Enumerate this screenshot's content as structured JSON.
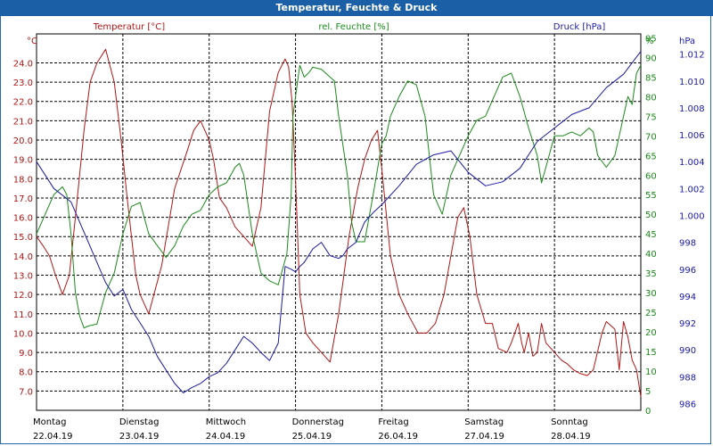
{
  "window": {
    "title": "Temperatur, Feuchte & Druck"
  },
  "colors": {
    "temperature": "#b31515",
    "humidity": "#1a8a1a",
    "pressure": "#1a1aa8",
    "titlebar": "#1b5fa6"
  },
  "chart_data": {
    "type": "line",
    "title": "Temperatur, Feuchte & Druck",
    "grid": true,
    "x": {
      "range_days": [
        0,
        7
      ],
      "days": [
        {
          "name": "Montag",
          "date": "22.04.19"
        },
        {
          "name": "Dienstag",
          "date": "23.04.19"
        },
        {
          "name": "Mittwoch",
          "date": "24.04.19"
        },
        {
          "name": "Donnerstag",
          "date": "25.04.19"
        },
        {
          "name": "Freitag",
          "date": "26.04.19"
        },
        {
          "name": "Samstag",
          "date": "27.04.19"
        },
        {
          "name": "Sonntag",
          "date": "28.04.19"
        }
      ]
    },
    "axes": {
      "temperature": {
        "unit": "°C",
        "label": "Temperatur [°C]",
        "min": 6.0,
        "max": 25.5,
        "ticks": [
          "7.0",
          "8.0",
          "9.0",
          "10.0",
          "11.0",
          "12.0",
          "13.0",
          "14.0",
          "15.0",
          "16.0",
          "17.0",
          "18.0",
          "19.0",
          "20.0",
          "21.0",
          "22.0",
          "23.0",
          "24.0"
        ]
      },
      "humidity": {
        "unit": "%",
        "label": "rel. Feuchte [%]",
        "min": 0,
        "max": 96,
        "ticks": [
          "0",
          "5",
          "10",
          "15",
          "20",
          "25",
          "30",
          "35",
          "40",
          "45",
          "50",
          "55",
          "60",
          "65",
          "70",
          "75",
          "80",
          "85",
          "90",
          "95"
        ]
      },
      "pressure": {
        "unit": "hPa",
        "label": "Druck [hPa]",
        "min": 985.5,
        "max": 1013.5,
        "ticks": [
          "986",
          "988",
          "990",
          "992",
          "994",
          "996",
          "998",
          "1.000",
          "1.002",
          "1.004",
          "1.006",
          "1.008",
          "1.010",
          "1.012"
        ]
      }
    },
    "series": [
      {
        "name": "Temperatur [°C]",
        "axis": "temperature",
        "color": "#b31515",
        "x": [
          0,
          0.08,
          0.15,
          0.22,
          0.3,
          0.38,
          0.45,
          0.55,
          0.62,
          0.7,
          0.8,
          0.9,
          0.98,
          1.05,
          1.1,
          1.15,
          1.2,
          1.3,
          1.45,
          1.6,
          1.75,
          1.82,
          1.9,
          2.0,
          2.05,
          2.12,
          2.2,
          2.3,
          2.4,
          2.5,
          2.6,
          2.7,
          2.8,
          2.88,
          2.92,
          2.96,
          3.0,
          3.05,
          3.12,
          3.2,
          3.3,
          3.4,
          3.5,
          3.62,
          3.72,
          3.8,
          3.88,
          3.95,
          4.0,
          4.1,
          4.2,
          4.3,
          4.42,
          4.52,
          4.62,
          4.72,
          4.8,
          4.88,
          4.95,
          5.02,
          5.1,
          5.2,
          5.28,
          5.35,
          5.45,
          5.5,
          5.58,
          5.62,
          5.65,
          5.7,
          5.75,
          5.8,
          5.85,
          5.9,
          6.0,
          6.08,
          6.15,
          6.22,
          6.3,
          6.38,
          6.45,
          6.55,
          6.6,
          6.65,
          6.7,
          6.75,
          6.8,
          6.85,
          6.9,
          6.95,
          7.0
        ],
        "y": [
          15.0,
          14.5,
          14.0,
          13.0,
          12.0,
          13.0,
          16.0,
          20.5,
          23.0,
          24.0,
          24.7,
          23.0,
          20.0,
          17.0,
          15.0,
          13.0,
          12.0,
          11.0,
          13.5,
          17.5,
          19.5,
          20.5,
          21.0,
          20.0,
          19.0,
          17.0,
          16.5,
          15.5,
          15.0,
          14.5,
          16.5,
          21.5,
          23.5,
          24.2,
          23.8,
          22.0,
          18.0,
          12.0,
          10.0,
          9.5,
          9.0,
          8.5,
          11.0,
          15.0,
          17.5,
          19.0,
          20.0,
          20.5,
          18.5,
          14.0,
          12.0,
          11.0,
          10.0,
          10.0,
          10.5,
          12.0,
          14.0,
          16.0,
          16.5,
          15.0,
          12.0,
          10.5,
          10.5,
          9.2,
          9.0,
          9.5,
          10.5,
          9.5,
          9.0,
          10.0,
          8.8,
          9.0,
          10.5,
          9.5,
          9.0,
          8.6,
          8.4,
          8.1,
          7.9,
          7.8,
          8.1,
          10.0,
          10.6,
          10.4,
          10.2,
          8.1,
          10.6,
          9.8,
          8.6,
          8.1,
          6.7
        ]
      },
      {
        "name": "rel. Feuchte [%]",
        "axis": "humidity",
        "color": "#1a8a1a",
        "x": [
          0,
          0.1,
          0.2,
          0.3,
          0.35,
          0.4,
          0.45,
          0.5,
          0.55,
          0.6,
          0.7,
          0.8,
          0.9,
          1.0,
          1.1,
          1.2,
          1.3,
          1.4,
          1.5,
          1.6,
          1.7,
          1.8,
          1.9,
          2.0,
          2.1,
          2.2,
          2.3,
          2.35,
          2.4,
          2.5,
          2.6,
          2.7,
          2.8,
          2.9,
          2.95,
          2.97,
          3.0,
          3.05,
          3.1,
          3.15,
          3.2,
          3.3,
          3.4,
          3.45,
          3.5,
          3.6,
          3.65,
          3.7,
          3.8,
          3.9,
          4.0,
          4.05,
          4.1,
          4.2,
          4.3,
          4.4,
          4.5,
          4.6,
          4.7,
          4.8,
          4.9,
          5.0,
          5.1,
          5.2,
          5.3,
          5.4,
          5.5,
          5.6,
          5.7,
          5.8,
          5.85,
          5.9,
          6.0,
          6.1,
          6.2,
          6.3,
          6.4,
          6.45,
          6.5,
          6.6,
          6.7,
          6.75,
          6.8,
          6.85,
          6.9,
          6.95,
          7.0
        ],
        "y": [
          45.0,
          50.0,
          55.0,
          57.0,
          55.0,
          45.0,
          30.0,
          24.0,
          21.0,
          21.5,
          22.0,
          30.0,
          35.0,
          45.0,
          52.0,
          53.0,
          45.0,
          42.0,
          39.0,
          42.0,
          47.0,
          50.0,
          51.0,
          55.0,
          57.0,
          58.0,
          62.0,
          63.0,
          60.0,
          45.0,
          35.0,
          33.0,
          32.0,
          40.0,
          55.0,
          75.0,
          80.0,
          88.0,
          85.0,
          86.0,
          87.5,
          87.0,
          85.0,
          84.0,
          75.0,
          60.0,
          48.0,
          43.0,
          43.0,
          55.0,
          68.0,
          70.0,
          75.0,
          80.0,
          84.0,
          83.0,
          75.0,
          55.0,
          50.0,
          60.0,
          65.0,
          70.0,
          74.0,
          75.0,
          80.0,
          85.0,
          86.0,
          80.0,
          72.0,
          65.0,
          58.0,
          62.0,
          70.0,
          70.0,
          71.0,
          70.0,
          72.0,
          71.0,
          65.0,
          62.0,
          65.0,
          70.0,
          75.0,
          80.0,
          78.0,
          86.0,
          88.0
        ]
      },
      {
        "name": "Druck [hPa]",
        "axis": "pressure",
        "color": "#1a1aa8",
        "x": [
          0,
          0.2,
          0.4,
          0.6,
          0.8,
          0.9,
          1.0,
          1.1,
          1.2,
          1.3,
          1.4,
          1.5,
          1.6,
          1.7,
          1.8,
          1.9,
          2.0,
          2.1,
          2.2,
          2.3,
          2.4,
          2.5,
          2.6,
          2.7,
          2.8,
          2.88,
          2.95,
          3.0,
          3.05,
          3.1,
          3.2,
          3.3,
          3.4,
          3.5,
          3.55,
          3.6,
          3.7,
          3.8,
          3.9,
          4.0,
          4.2,
          4.4,
          4.6,
          4.8,
          5.0,
          5.2,
          5.4,
          5.6,
          5.8,
          6.0,
          6.2,
          6.4,
          6.6,
          6.8,
          7.0
        ],
        "y": [
          1004.0,
          1002.0,
          1001.0,
          998.0,
          995.0,
          994.0,
          994.5,
          993.0,
          992.0,
          991.0,
          989.5,
          988.5,
          987.5,
          986.8,
          987.2,
          987.5,
          988.0,
          988.3,
          989.0,
          990.0,
          991.0,
          990.5,
          989.8,
          989.2,
          990.5,
          996.2,
          996.0,
          995.8,
          996.2,
          996.5,
          997.5,
          998.0,
          997.0,
          996.8,
          997.0,
          997.5,
          998.0,
          999.5,
          1000.2,
          1000.8,
          1002.2,
          1003.8,
          1004.5,
          1004.8,
          1003.2,
          1002.2,
          1002.5,
          1003.5,
          1005.5,
          1006.5,
          1007.5,
          1008.0,
          1009.5,
          1010.5,
          1012.2
        ]
      }
    ]
  }
}
